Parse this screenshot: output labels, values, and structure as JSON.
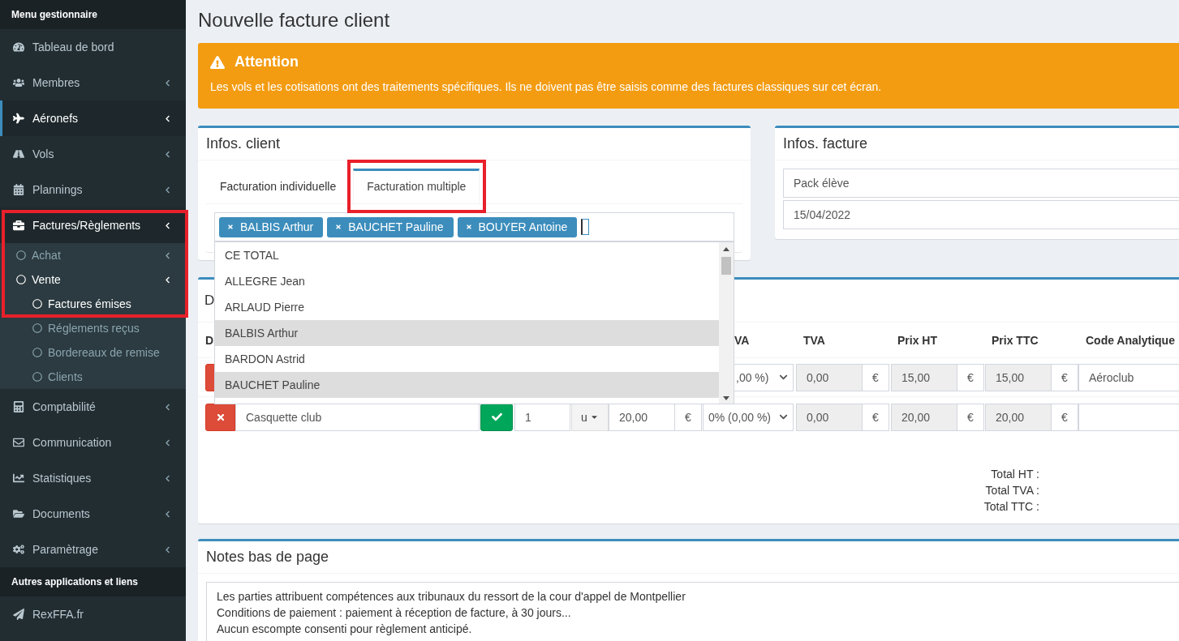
{
  "sidebar": {
    "sections": [
      {
        "header": "Menu gestionnaire",
        "items": [
          {
            "label": "Tableau de bord",
            "selected": false
          },
          {
            "label": "Membres",
            "selected": false,
            "expanded": false
          },
          {
            "label": "Aéronefs",
            "selected": true,
            "expanded": false
          },
          {
            "label": "Vols",
            "selected": false,
            "expanded": false
          },
          {
            "label": "Plannings",
            "selected": false,
            "expanded": false
          },
          {
            "label": "Factures/Règlements",
            "selected": false,
            "expanded": true,
            "children": [
              {
                "label": "Achat",
                "expanded": false
              },
              {
                "label": "Vente",
                "expanded": true,
                "children": [
                  {
                    "label": "Factures émises",
                    "selected": true
                  },
                  {
                    "label": "Réglements reçus",
                    "selected": false
                  },
                  {
                    "label": "Bordereaux de remise",
                    "selected": false
                  },
                  {
                    "label": "Clients",
                    "selected": false
                  }
                ]
              }
            ]
          },
          {
            "label": "Comptabilité",
            "selected": false,
            "expanded": false
          },
          {
            "label": "Communication",
            "selected": false,
            "expanded": false
          },
          {
            "label": "Statistiques",
            "selected": false,
            "expanded": false
          },
          {
            "label": "Documents",
            "selected": false,
            "expanded": false
          },
          {
            "label": "Paramètrage",
            "selected": false,
            "expanded": false
          }
        ]
      },
      {
        "header": "Autres applications et liens",
        "items": [
          {
            "label": "RexFFA.fr",
            "selected": false
          }
        ]
      }
    ]
  },
  "page_title": "Nouvelle facture client",
  "alert": {
    "title": "Attention",
    "message": "Les vols et les cotisations ont des traitements spécifiques. Ils ne doivent pas être saisis comme des factures classiques sur cet écran."
  },
  "client_panel": {
    "title": "Infos. client",
    "tabs": [
      {
        "label": "Facturation individuelle",
        "selected": false
      },
      {
        "label": "Facturation multiple",
        "selected": true
      }
    ],
    "tags": [
      "BALBIS Arthur",
      "BAUCHET Pauline",
      "BOUYER Antoine"
    ],
    "dropdown": [
      {
        "label": "CE TOTAL",
        "selected": false
      },
      {
        "label": "ALLEGRE Jean",
        "selected": false
      },
      {
        "label": "ARLAUD Pierre",
        "selected": false
      },
      {
        "label": "BALBIS Arthur",
        "selected": true
      },
      {
        "label": "BARDON Astrid",
        "selected": false
      },
      {
        "label": "BAUCHET Pauline",
        "selected": true
      }
    ]
  },
  "invoice_panel": {
    "title": "Infos. facture",
    "fields": [
      {
        "value": "Pack élève"
      },
      {
        "value": "15/04/2022"
      }
    ]
  },
  "lines_panel": {
    "title": "D",
    "columns": [
      "D",
      "VA",
      "TVA",
      "Prix HT",
      "Prix TTC",
      "Code Analytique"
    ],
    "rows": [
      {
        "kind": "covered",
        "tva_rate": ",00 %)",
        "tva": "0,00",
        "tva_unit": "€",
        "ht": "15,00",
        "ht_unit": "€",
        "ttc": "15,00",
        "ttc_unit": "€",
        "code": "Aéroclub"
      },
      {
        "kind": "full",
        "description": "Casquette club",
        "qty": "1",
        "unit": "u",
        "price": "20,00",
        "price_unit": "€",
        "tva_rate": "0% (0,00 %)",
        "tva": "0,00",
        "tva_unit": "€",
        "ht": "20,00",
        "ht_unit": "€",
        "ttc": "20,00",
        "ttc_unit": "€"
      }
    ],
    "totals": [
      "Total HT :",
      "Total TVA :",
      "Total TTC :"
    ]
  },
  "notes_panel": {
    "title": "Notes bas de page",
    "lines": [
      "Les parties attribuent compétences aux tribunaux du ressort de la cour d'appel de Montpellier",
      "Conditions de paiement : paiement à réception de facture, à 30 jours...",
      "Aucun escompte consenti pour règlement anticipé."
    ]
  }
}
